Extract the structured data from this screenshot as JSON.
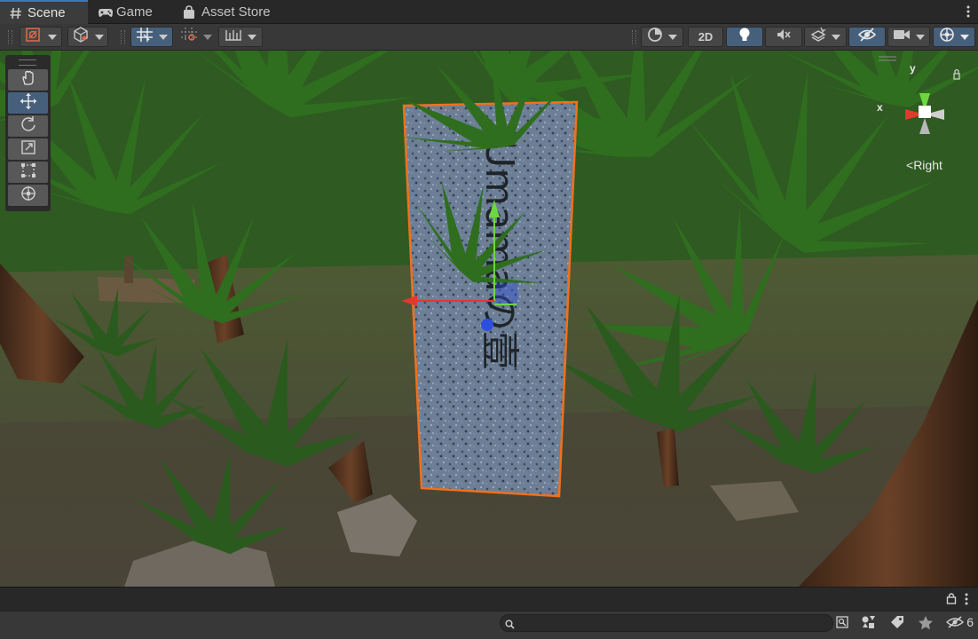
{
  "tabs": [
    {
      "label": "Scene",
      "icon": "hash-icon",
      "active": true
    },
    {
      "label": "Game",
      "icon": "gamepad-icon",
      "active": false
    },
    {
      "label": "Asset Store",
      "icon": "shopping-bag-icon",
      "active": false
    }
  ],
  "toolbar": {
    "mode_2d_label": "2D",
    "left_tools": [
      "tool-handle-icon",
      "cube-icon",
      "grid-snap-icon",
      "increment-snap-icon",
      "ruler-icon"
    ],
    "right_tools": [
      "draw-mode-icon",
      "lighting-icon",
      "audio-mute-icon",
      "effects-icon",
      "hidden-objects-icon",
      "camera-icon",
      "gizmos-icon"
    ]
  },
  "palette": {
    "tools": [
      "hand-icon",
      "move-icon",
      "rotate-icon",
      "scale-icon",
      "rect-icon",
      "transform-icon"
    ],
    "selected": "move-icon"
  },
  "gizmo": {
    "view_label": "Right",
    "axis_x": "x",
    "axis_y": "y"
  },
  "status": {
    "search_placeholder": "",
    "hidden_count": "6"
  },
  "colors": {
    "accent": "#3a79bb",
    "selection_outline": "#f2701c",
    "axis_x": "#e03a2c",
    "axis_y": "#6fd641",
    "axis_z": "#2d4fe0"
  },
  "signboard_text": "Umamaの壹"
}
